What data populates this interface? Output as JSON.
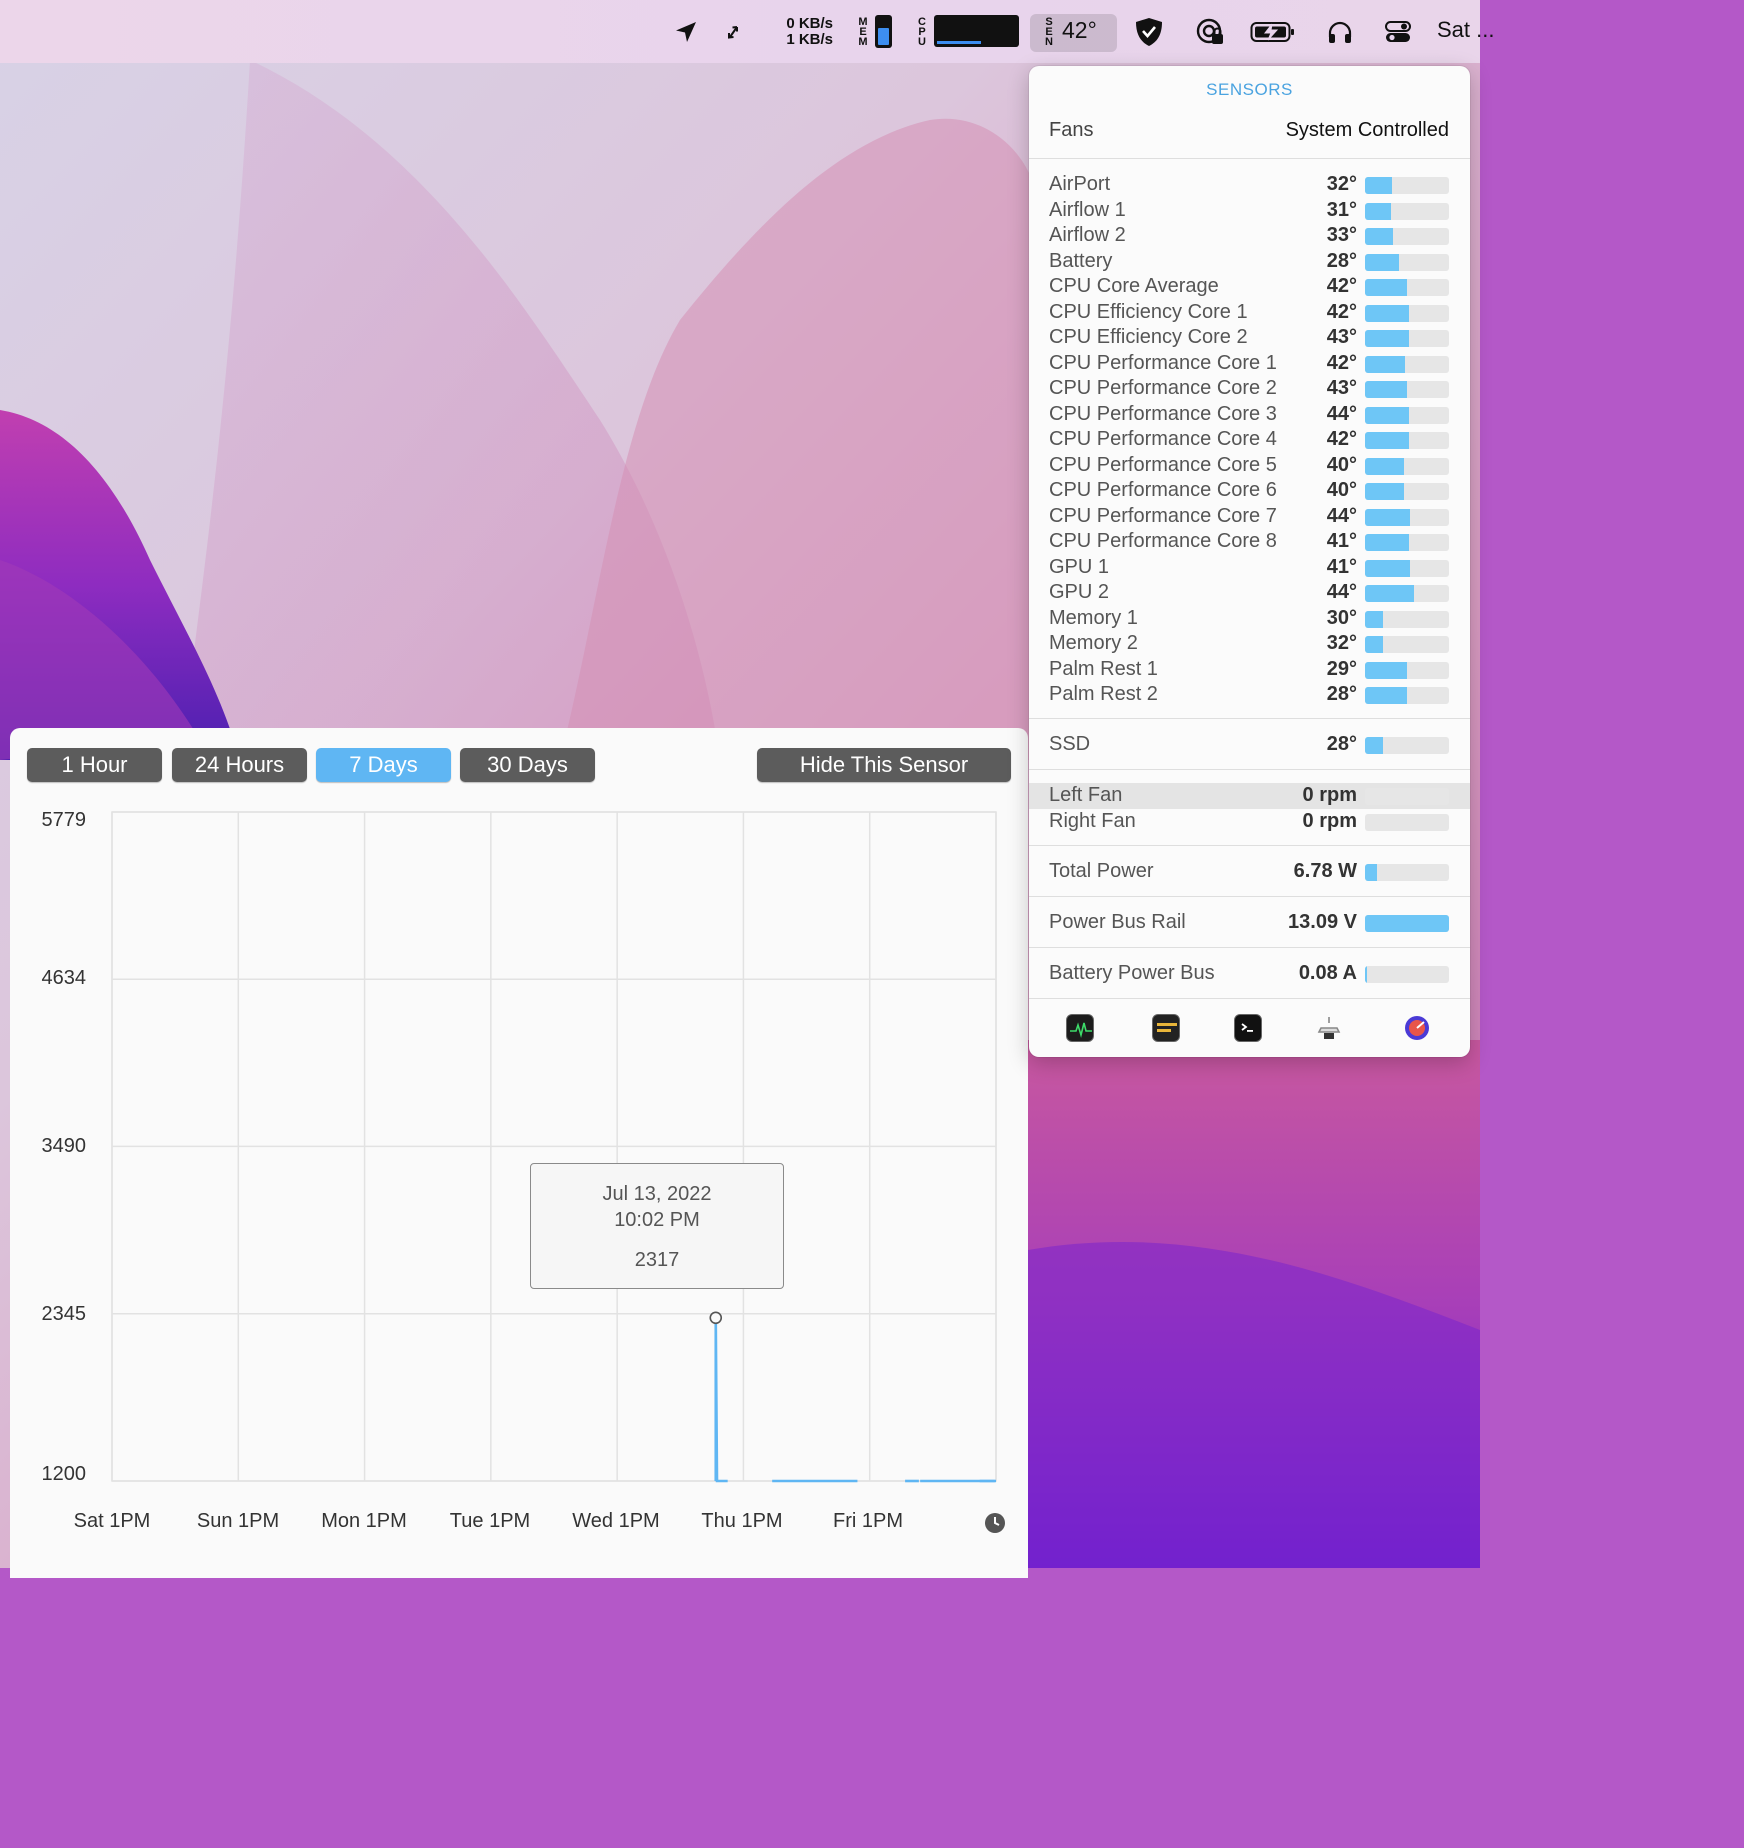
{
  "menubar": {
    "net_down": "0 KB/s",
    "net_up": "1 KB/s",
    "mem_label": "MEM",
    "cpu_label": "CPU",
    "sen_label": "SEN",
    "sensor_temp": "42°",
    "clock": "Sat ..."
  },
  "chart_panel": {
    "ranges": [
      "1 Hour",
      "24 Hours",
      "7 Days",
      "30 Days"
    ],
    "active_range": "7 Days",
    "hide_button": "Hide This Sensor",
    "tooltip": {
      "date": "Jul 13, 2022",
      "time": "10:02 PM",
      "value": "2317"
    },
    "accent_color": "#5fb6f3"
  },
  "chart_data": {
    "type": "line",
    "yticks": [
      "5779",
      "4634",
      "3490",
      "2345",
      "1200"
    ],
    "ylim": [
      1200,
      5779
    ],
    "xticks": [
      "Sat 1PM",
      "Sun 1PM",
      "Mon 1PM",
      "Tue 1PM",
      "Wed 1PM",
      "Thu 1PM",
      "Fri 1PM"
    ],
    "xlim_hours": [
      0,
      141
    ],
    "series": [
      {
        "color": "#5fb6f3",
        "segments": [
          [
            [
              96.3,
              1200
            ],
            [
              96.3,
              2317
            ],
            [
              96.5,
              1200
            ],
            [
              98.2,
              1200
            ]
          ],
          [
            [
              105.3,
              1200
            ],
            [
              118.9,
              1200
            ]
          ],
          [
            [
              126.5,
              1200
            ],
            [
              128.7,
              1200
            ]
          ],
          [
            [
              128.9,
              1200
            ],
            [
              140.8,
              1200
            ]
          ],
          [
            [
              138.4,
              1200
            ],
            [
              141.0,
              1200
            ]
          ]
        ]
      }
    ],
    "highlight": {
      "x_hours": 96.3,
      "y": 2317
    },
    "grid": true
  },
  "sensors": {
    "title": "SENSORS",
    "fans_label": "Fans",
    "fans_mode": "System Controlled",
    "temps": [
      {
        "name": "AirPort",
        "value": "32°",
        "level": 0.32
      },
      {
        "name": "Airflow 1",
        "value": "31°",
        "level": 0.31
      },
      {
        "name": "Airflow 2",
        "value": "33°",
        "level": 0.33
      },
      {
        "name": "Battery",
        "value": "28°",
        "level": 0.4
      },
      {
        "name": "CPU Core Average",
        "value": "42°",
        "level": 0.5
      },
      {
        "name": "CPU Efficiency Core 1",
        "value": "42°",
        "level": 0.52
      },
      {
        "name": "CPU Efficiency Core 2",
        "value": "43°",
        "level": 0.52
      },
      {
        "name": "CPU Performance Core 1",
        "value": "42°",
        "level": 0.48
      },
      {
        "name": "CPU Performance Core 2",
        "value": "43°",
        "level": 0.5
      },
      {
        "name": "CPU Performance Core 3",
        "value": "44°",
        "level": 0.52
      },
      {
        "name": "CPU Performance Core 4",
        "value": "42°",
        "level": 0.52
      },
      {
        "name": "CPU Performance Core 5",
        "value": "40°",
        "level": 0.46
      },
      {
        "name": "CPU Performance Core 6",
        "value": "40°",
        "level": 0.46
      },
      {
        "name": "CPU Performance Core 7",
        "value": "44°",
        "level": 0.54
      },
      {
        "name": "CPU Performance Core 8",
        "value": "41°",
        "level": 0.52
      },
      {
        "name": "GPU 1",
        "value": "41°",
        "level": 0.54
      },
      {
        "name": "GPU 2",
        "value": "44°",
        "level": 0.58
      },
      {
        "name": "Memory 1",
        "value": "30°",
        "level": 0.22
      },
      {
        "name": "Memory 2",
        "value": "32°",
        "level": 0.22
      },
      {
        "name": "Palm Rest 1",
        "value": "29°",
        "level": 0.5
      },
      {
        "name": "Palm Rest 2",
        "value": "28°",
        "level": 0.5
      }
    ],
    "ssd": {
      "name": "SSD",
      "value": "28°",
      "level": 0.22
    },
    "fans": [
      {
        "name": "Left Fan",
        "value": "0 rpm",
        "level": 0
      },
      {
        "name": "Right Fan",
        "value": "0 rpm",
        "level": 0
      }
    ],
    "power": [
      {
        "name": "Total Power",
        "value": "6.78 W",
        "level": 0.14
      },
      {
        "name": "Power Bus Rail",
        "value": "13.09 V",
        "level": 1.0
      },
      {
        "name": "Battery Power Bus",
        "value": "0.08 A",
        "level": 0.02
      }
    ],
    "app_icons": [
      "activity-monitor-icon",
      "console-icon",
      "terminal-icon",
      "system-information-icon",
      "disk-utility-icon"
    ]
  }
}
